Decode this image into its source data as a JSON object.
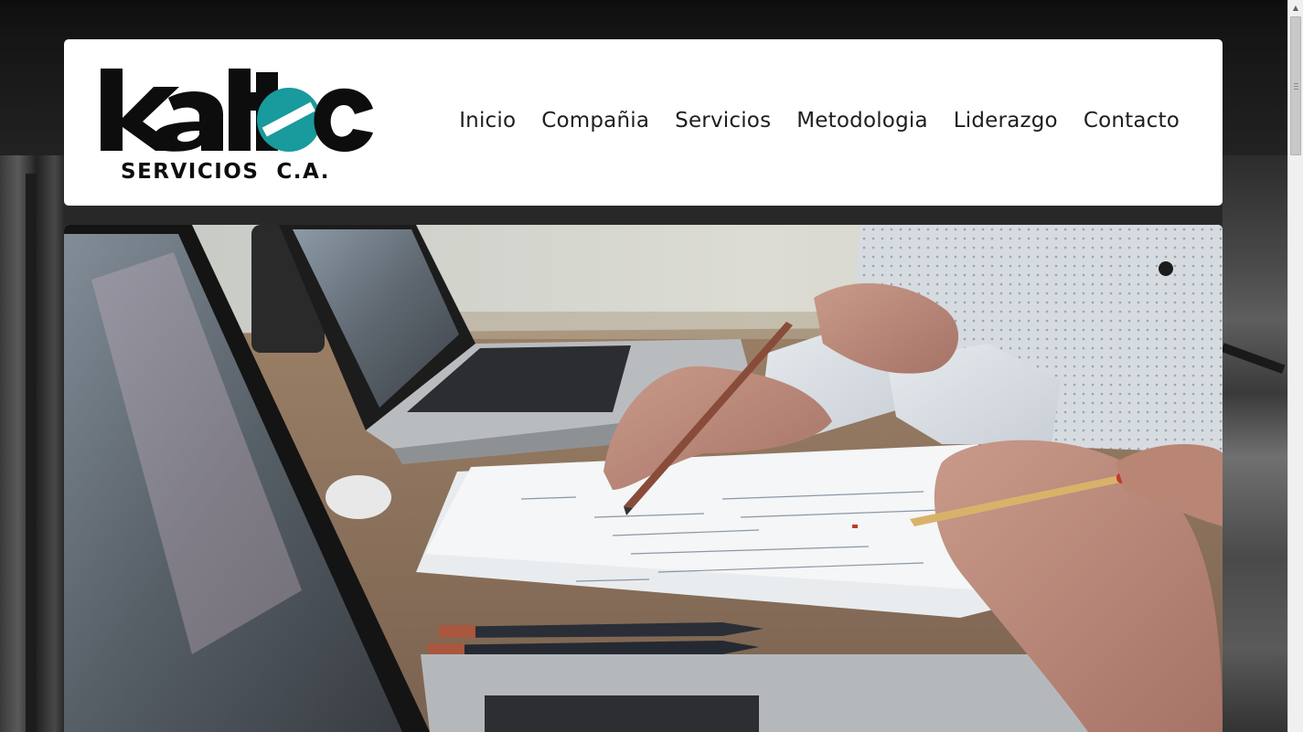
{
  "brand": {
    "logo_word": "kaltec",
    "logo_subtitle": "SERVICIOS  C.A.",
    "colors": {
      "primary": "#0d0d0d",
      "accent": "#199a9c"
    }
  },
  "nav": {
    "items": [
      {
        "label": "Inicio"
      },
      {
        "label": "Compañia"
      },
      {
        "label": "Servicios"
      },
      {
        "label": "Metodologia"
      },
      {
        "label": "Liderazgo"
      },
      {
        "label": "Contacto"
      }
    ]
  },
  "hero": {
    "image": "office-desk-laptops-documents-photo"
  },
  "scrollbar": {
    "up_icon": "arrow-up-icon"
  }
}
